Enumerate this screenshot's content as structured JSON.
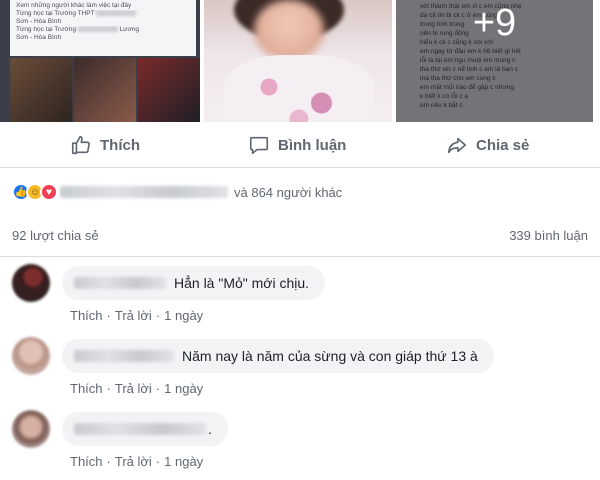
{
  "photos": {
    "card_rows": [
      "Xem những người khác làm việc tại đây",
      "Từng học tại Trường THPT",
      "Sơn - Hòa Bình",
      "Từng học tại Trường",
      "Lương",
      "Sơn - Hòa Bình"
    ],
    "more_count": "+9",
    "text_lines": [
      "với thành thật em xl c em cũng nhẹ",
      "dạ cả tin bị ck c ở em cũng",
      "trong tình trong",
      "nên bị rung động",
      "hiểu k ck c cũng k nói với",
      "em ngay từ đầu em k hề biết gì hết",
      "lỗi là tại em ngu muội em mong c",
      "tha thứ xin c nể tình c em là bạn c",
      "mà tha thứ cho em cung k",
      "em mặt mũi nào để gặp c nhưng",
      "k biết k có lỗi c ạ",
      "em nếu k bắt c"
    ]
  },
  "actions": {
    "like_label": "Thích",
    "comment_label": "Bình luận",
    "share_label": "Chia sẻ"
  },
  "reactions": {
    "others_text": "và 864 người khác"
  },
  "stats": {
    "shares": "92 lượt chia sẻ",
    "comments": "339 bình luận"
  },
  "comments": [
    {
      "text": "Hẳn là \"Mỏ\" mới chịu.",
      "like": "Thích",
      "reply": "Trả lời",
      "time": "1 ngày"
    },
    {
      "text": "Năm nay là năm của sừng và con giáp thứ 13 à",
      "like": "Thích",
      "reply": "Trả lời",
      "time": "1 ngày"
    },
    {
      "text": ".",
      "like": "Thích",
      "reply": "Trả lời",
      "time": "1 ngày"
    }
  ],
  "colors": {
    "like": "#1877f2",
    "haha": "#f7b928",
    "love": "#f33e58",
    "muted_text": "#606770",
    "bubble": "#f2f3f5"
  },
  "icons": [
    "thumbs-up-icon",
    "comment-icon",
    "share-icon",
    "like-reaction-icon",
    "haha-reaction-icon",
    "love-reaction-icon"
  ]
}
